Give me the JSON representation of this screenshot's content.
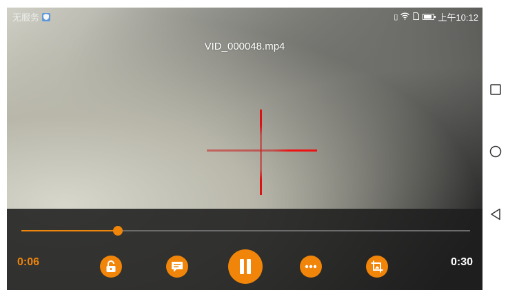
{
  "status_bar": {
    "carrier": "无服务",
    "time": "上午10:12"
  },
  "video": {
    "title": "VID_000048.mp4"
  },
  "playback": {
    "elapsed": "0:06",
    "duration": "0:30",
    "progress": 0.215,
    "state": "playing"
  },
  "controls": {
    "buttons": [
      {
        "name": "lock-button",
        "icon": "unlock-icon"
      },
      {
        "name": "subtitles-button",
        "icon": "subtitle-icon"
      },
      {
        "name": "pause-button",
        "icon": "pause-icon"
      },
      {
        "name": "more-options-button",
        "icon": "more-horiz-icon"
      },
      {
        "name": "crop-aspect-button",
        "icon": "crop-icon"
      }
    ]
  },
  "navigation": {
    "buttons": [
      "recents-square-icon",
      "home-circle-icon",
      "back-triangle-icon"
    ]
  },
  "colors": {
    "accent": "#f0850a",
    "reticle": "#dd1111",
    "controls_background": "#1e1e1e"
  }
}
